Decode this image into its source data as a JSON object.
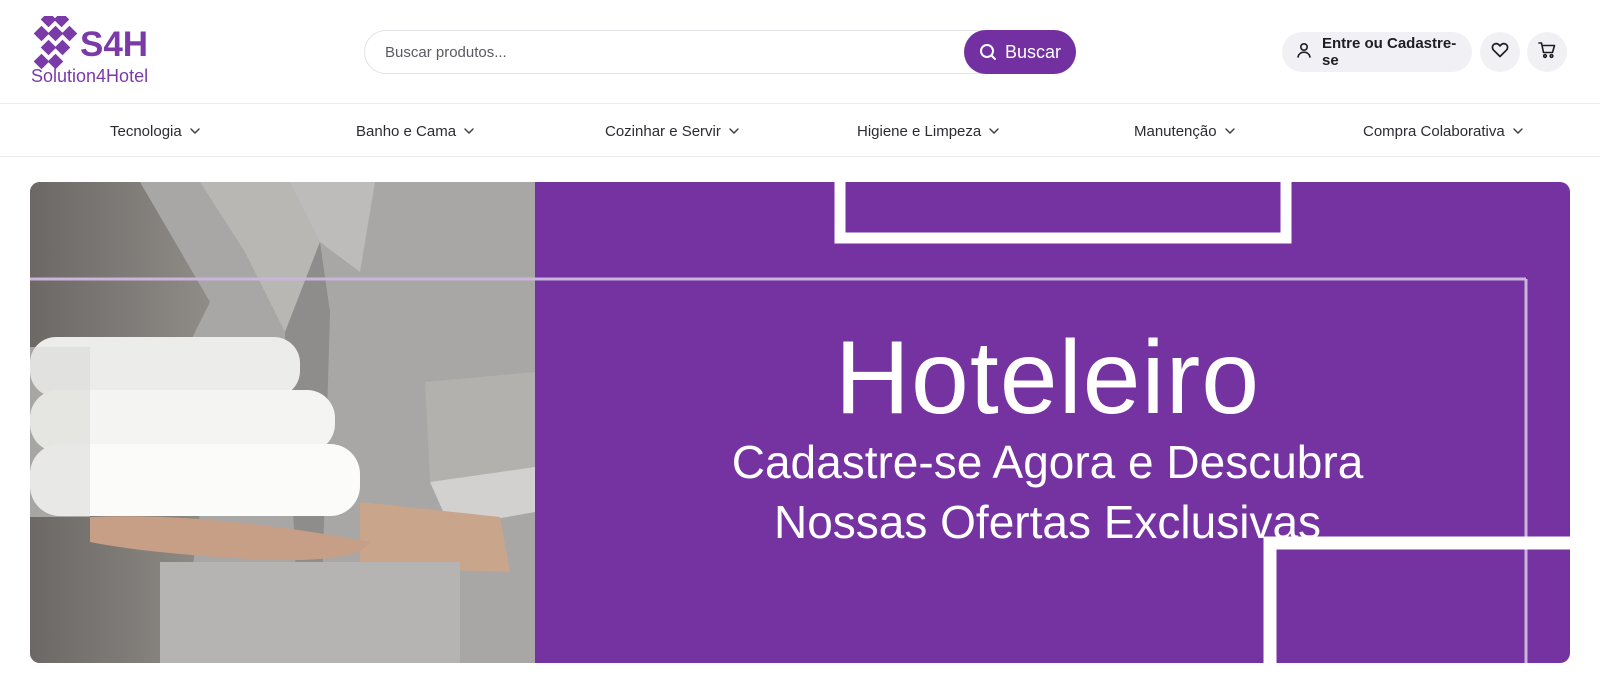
{
  "brand": {
    "logo_mark": "S4H",
    "logo_text": "Solution4Hotel",
    "accent_color": "#7230a0",
    "banner_color": "#7532a1"
  },
  "search": {
    "placeholder": "Buscar produtos...",
    "value": "",
    "button_label": "Buscar",
    "button_icon": "search-icon"
  },
  "account": {
    "label": "Entre ou Cadastre-se",
    "icon": "user-icon"
  },
  "actions": {
    "wishlist_icon": "heart-icon",
    "cart_icon": "cart-icon"
  },
  "nav": {
    "items": [
      {
        "label": "Tecnologia"
      },
      {
        "label": "Banho e Cama"
      },
      {
        "label": "Cozinhar e Servir"
      },
      {
        "label": "Higiene e Limpeza"
      },
      {
        "label": "Manutenção"
      },
      {
        "label": "Compra Colaborativa"
      }
    ],
    "dropdown_icon": "chevron-down-icon"
  },
  "banner": {
    "headline": "Hoteleiro",
    "line1": "Cadastre-se Agora e Descubra",
    "line2": "Nossas Ofertas Exclusivas",
    "image": "housekeeper-holding-white-towels"
  }
}
